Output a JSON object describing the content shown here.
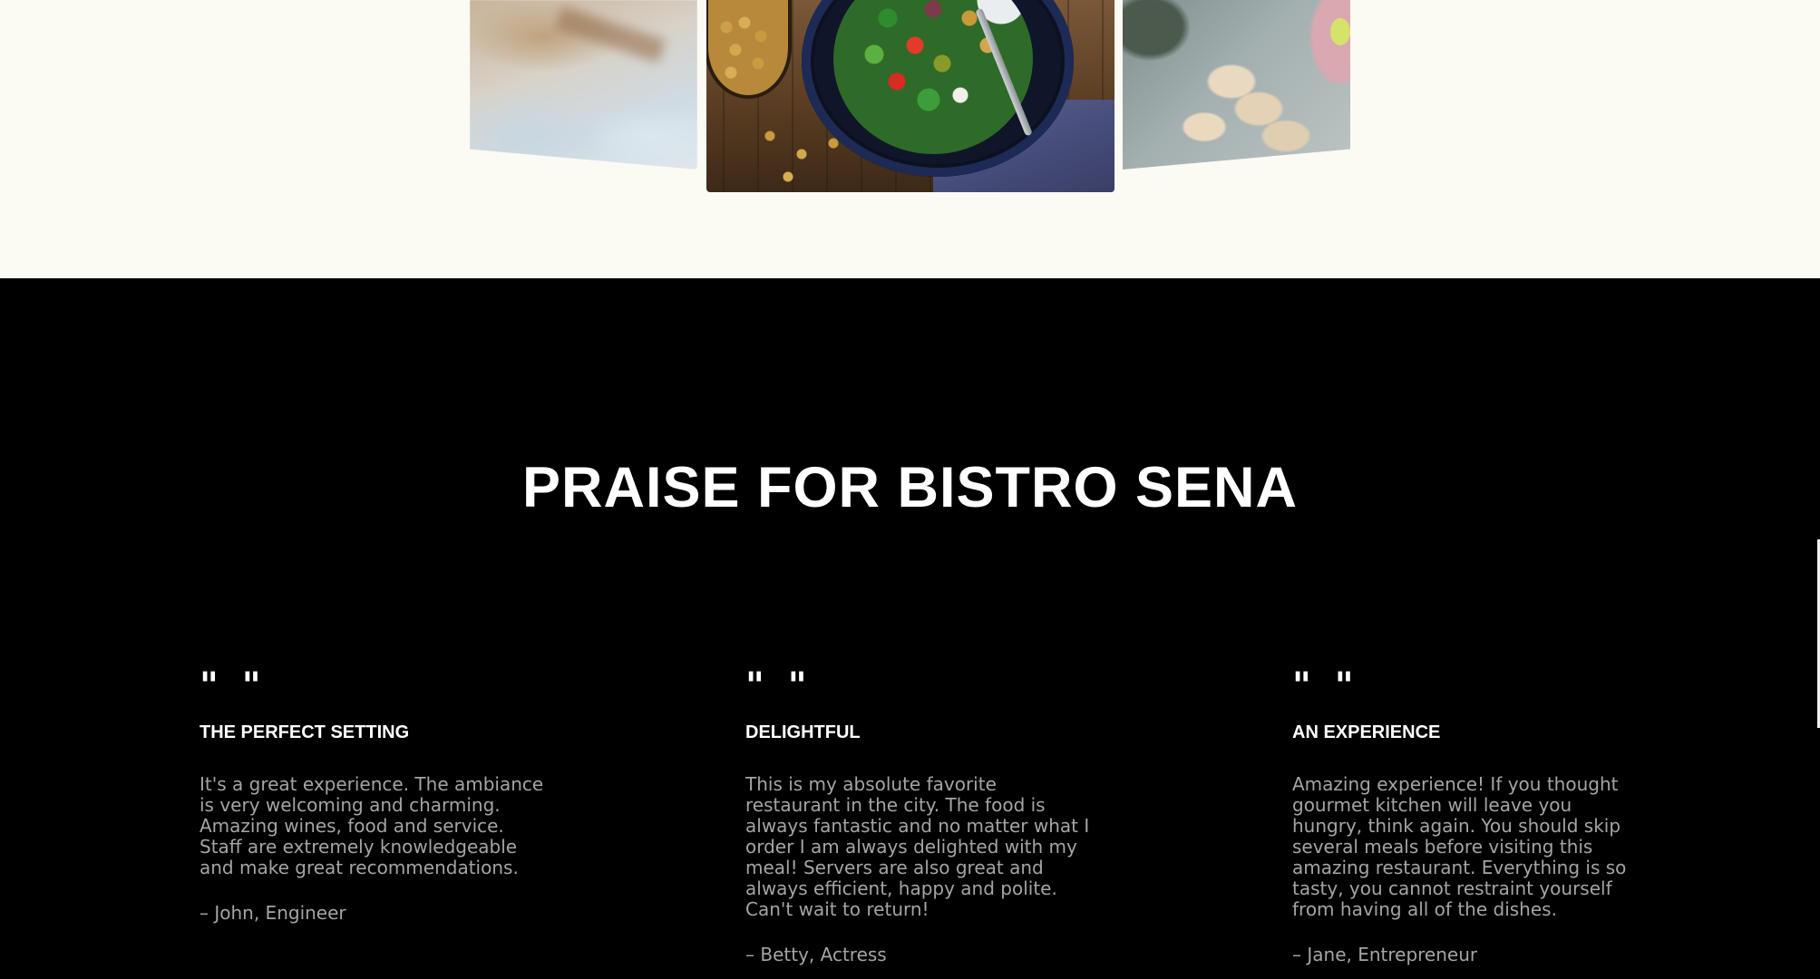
{
  "gallery": {
    "images": [
      "blurred-interior-photo",
      "chickpea-salad-bowl-photo",
      "dumplings-platter-photo"
    ]
  },
  "praise": {
    "title": "PRAISE FOR BISTRO SENA",
    "testimonials": [
      {
        "quote_mark": "\" \"",
        "title": "THE PERFECT SETTING",
        "text": "It's a great experience. The ambiance is very welcoming and charming. Amazing wines, food and service. Staff are extremely knowledgeable and make great recommendations.",
        "author": "– John, Engineer"
      },
      {
        "quote_mark": "\" \"",
        "title": "DELIGHTFUL",
        "text": "This is my absolute favorite restaurant in the city. The food is always fantastic and no matter what I order I am always delighted with my meal! Servers are also great and always efficient, happy and polite. Can't wait to return!",
        "author": "– Betty, Actress"
      },
      {
        "quote_mark": "\" \"",
        "title": "AN EXPERIENCE",
        "text": "Amazing experience! If you thought gourmet kitchen will leave you hungry, think again. You should skip several meals before visiting this amazing restaurant. Everything is so tasty, you cannot restraint yourself from having all of the dishes.",
        "author": "– Jane, Entrepreneur"
      }
    ]
  }
}
